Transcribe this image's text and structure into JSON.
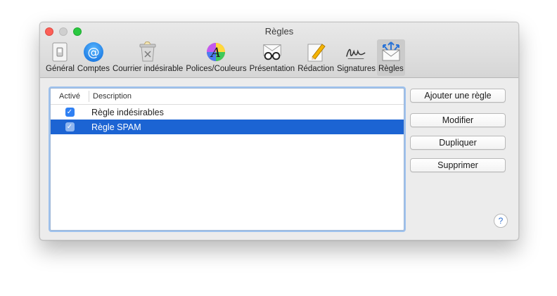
{
  "window": {
    "title": "Règles"
  },
  "toolbar": {
    "tabs": [
      {
        "label": "Général",
        "icon": "general-switch-icon"
      },
      {
        "label": "Comptes",
        "icon": "at-sign-icon"
      },
      {
        "label": "Courrier indésirable",
        "icon": "junk-trash-icon"
      },
      {
        "label": "Polices/Couleurs",
        "icon": "fonts-colors-icon"
      },
      {
        "label": "Présentation",
        "icon": "glasses-envelope-icon"
      },
      {
        "label": "Rédaction",
        "icon": "pencil-icon"
      },
      {
        "label": "Signatures",
        "icon": "signature-icon"
      },
      {
        "label": "Règles",
        "icon": "rules-envelope-icon"
      }
    ],
    "active_tab": "Règles"
  },
  "rules_table": {
    "columns": {
      "active": "Activé",
      "description": "Description"
    },
    "rows": [
      {
        "active": true,
        "description": "Règle indésirables",
        "selected": false
      },
      {
        "active": true,
        "description": "Règle SPAM",
        "selected": true
      }
    ]
  },
  "actions": {
    "add": "Ajouter une règle",
    "edit": "Modifier",
    "duplicate": "Dupliquer",
    "delete": "Supprimer"
  },
  "help": {
    "label": "?"
  },
  "colors": {
    "selection": "#1c64d3",
    "checkbox": "#2f80f3",
    "accent_focus": "#9ec2ee"
  }
}
